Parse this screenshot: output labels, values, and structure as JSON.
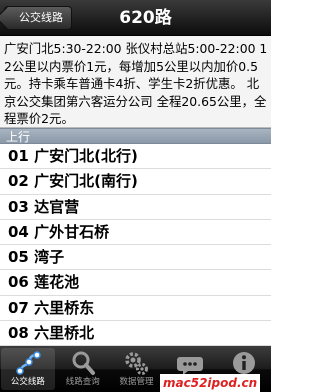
{
  "navbar": {
    "back_label": "公交线路",
    "title": "620路"
  },
  "info": {
    "text": "广安门北5:30-22:00 张仪村总站5:00-22:00 12公里以内票价1元，每增加5公里以内加价0.5元。持卡乘车普通卡4折、学生卡2折优惠。 北京公交集团第六客运分公司 全程20.65公里，全程票价2元。"
  },
  "section": {
    "title": "上行"
  },
  "stops": [
    "01 广安门北(北行)",
    "02 广安门北(南行)",
    "03 达官营",
    "04 广外甘石桥",
    "05 湾子",
    "06 莲花池",
    "07 六里桥东",
    "08 六里桥北"
  ],
  "tabs": [
    {
      "label": "公交线路",
      "icon": "route-icon",
      "active": true
    },
    {
      "label": "线路查询",
      "icon": "search-icon",
      "active": false
    },
    {
      "label": "数据管理",
      "icon": "gear-icon",
      "active": false
    },
    {
      "label": "",
      "icon": "more-icon",
      "active": false
    },
    {
      "label": "",
      "icon": "info-icon",
      "active": false
    }
  ],
  "watermark": "mac52ipod.cn",
  "colors": {
    "navbar": "#0c0c0c",
    "section_header": "#98a4b3",
    "watermark": "#dd2222"
  }
}
